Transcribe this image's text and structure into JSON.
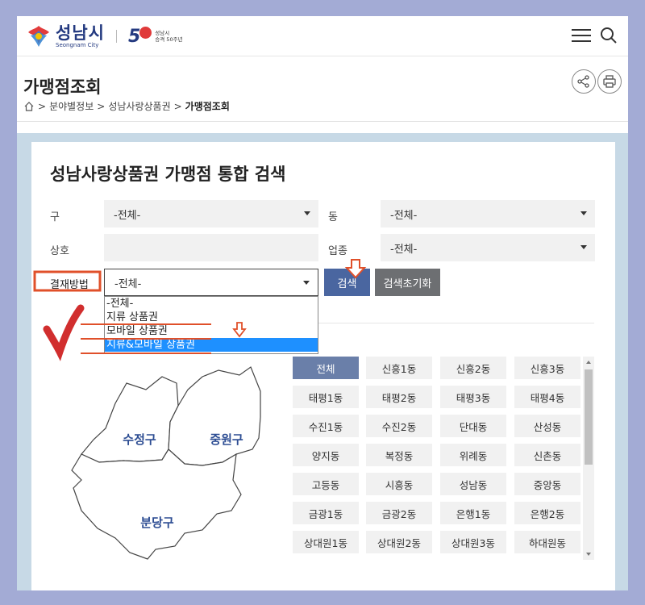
{
  "header": {
    "logo_ko": "성남시",
    "logo_en": "Seongnam City",
    "anniv_num": "5",
    "anniv_line1": "성남시",
    "anniv_line2": "승격 50주년"
  },
  "page": {
    "title": "가맹점조회",
    "breadcrumb": [
      ">",
      "분야별정보",
      ">",
      "성남사랑상품권",
      ">",
      "가맹점조회"
    ]
  },
  "search": {
    "title": "성남사랑상품권 가맹점 통합 검색",
    "gu_label": "구",
    "gu_value": "-전체-",
    "dong_label": "동",
    "dong_value": "-전체-",
    "name_label": "상호",
    "name_value": "",
    "biz_label": "업종",
    "biz_value": "-전체-",
    "pay_label": "결재방법",
    "pay_value": "-전체-",
    "search_button": "검색",
    "reset_button": "검색초기화",
    "pay_options": [
      "-전체-",
      "지류 상품권",
      "모바일 상품권",
      "지류&모바일 상품권"
    ],
    "pay_selected_index": 3
  },
  "map": {
    "regions": [
      "수정구",
      "중원구",
      "분당구"
    ]
  },
  "dongs": [
    [
      "전체",
      "신흥1동",
      "신흥2동",
      "신흥3동"
    ],
    [
      "태평1동",
      "태평2동",
      "태평3동",
      "태평4동"
    ],
    [
      "수진1동",
      "수진2동",
      "단대동",
      "산성동"
    ],
    [
      "양지동",
      "복정동",
      "위례동",
      "신촌동"
    ],
    [
      "고등동",
      "시흥동",
      "성남동",
      "중앙동"
    ],
    [
      "금광1동",
      "금광2동",
      "은행1동",
      "은행2동"
    ],
    [
      "상대원1동",
      "상대원2동",
      "상대원3동",
      "하대원동"
    ]
  ],
  "colors": {
    "background": "#a3abd5",
    "brand": "#243a80",
    "search_button": "#4a66a0",
    "reset_button": "#6d6f72",
    "active_cell": "#6a7fa9",
    "dropdown_highlight": "#1e90ff",
    "annotation": "#e0502a"
  }
}
